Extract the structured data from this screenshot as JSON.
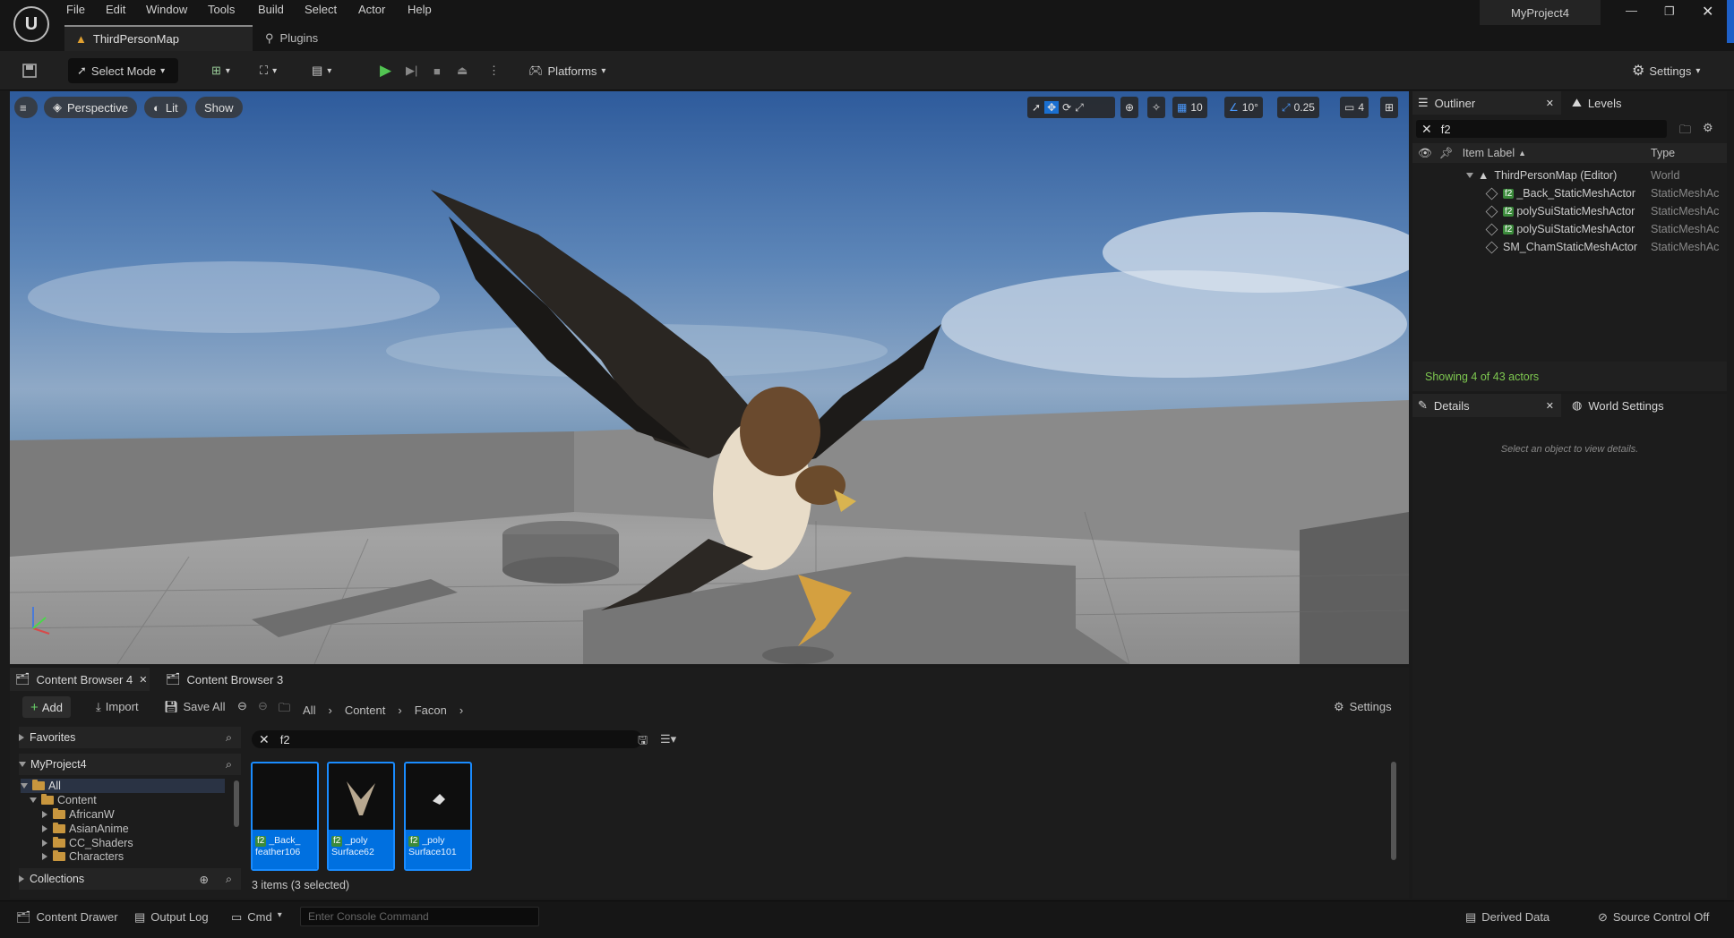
{
  "app": {
    "window_title": "MyProject4"
  },
  "menu": [
    "File",
    "Edit",
    "Window",
    "Tools",
    "Build",
    "Select",
    "Actor",
    "Help"
  ],
  "doc_tabs": [
    {
      "label": "ThirdPersonMap"
    },
    {
      "label": "Plugins"
    }
  ],
  "toolbar": {
    "select_mode": "Select Mode",
    "platforms": "Platforms",
    "settings": "Settings"
  },
  "viewport": {
    "perspective": "Perspective",
    "lit": "Lit",
    "show": "Show",
    "grid_snap": "10",
    "rot_snap": "10°",
    "scale_snap": "0.25",
    "camera_speed": "4"
  },
  "outliner": {
    "tab": "Outliner",
    "levels_tab": "Levels",
    "search_value": "f2",
    "col_label": "Item Label",
    "col_type": "Type",
    "rows": [
      {
        "label": "ThirdPersonMap (Editor)",
        "type": "World",
        "tag": ""
      },
      {
        "label": "_Back_StaticMeshActor",
        "type": "StaticMeshAc",
        "tag": "f2"
      },
      {
        "label": "polySuiStaticMeshActor",
        "type": "StaticMeshAc",
        "tag": "f2"
      },
      {
        "label": "polySuiStaticMeshActor",
        "type": "StaticMeshAc",
        "tag": "f2"
      },
      {
        "label": "SM_ChamStaticMeshActor",
        "type": "StaticMeshAc",
        "tag": ""
      }
    ],
    "status": "Showing 4 of 43 actors"
  },
  "details": {
    "tab": "Details",
    "world_tab": "World Settings",
    "empty_msg": "Select an object to view details."
  },
  "content_browser": {
    "tab1": "Content Browser 4",
    "tab2": "Content Browser 3",
    "add": "Add",
    "import": "Import",
    "save_all": "Save All",
    "breadcrumb": [
      "All",
      "Content",
      "Facon"
    ],
    "settings": "Settings",
    "favorites": "Favorites",
    "project": "MyProject4",
    "tree": [
      "All",
      "Content",
      "AfricanW",
      "AsianAnime",
      "CC_Shaders",
      "Characters"
    ],
    "collections": "Collections",
    "search_value": "f2",
    "assets": [
      {
        "tag": "f2",
        "line1": "_Back_",
        "line2": "feather106"
      },
      {
        "tag": "f2",
        "line1": "_poly",
        "line2": "Surface62"
      },
      {
        "tag": "f2",
        "line1": "_poly",
        "line2": "Surface101"
      }
    ],
    "status": "3 items (3 selected)"
  },
  "statusbar": {
    "content_drawer": "Content Drawer",
    "output_log": "Output Log",
    "cmd": "Cmd",
    "console_placeholder": "Enter Console Command",
    "derived_data": "Derived Data",
    "source_control": "Source Control Off"
  }
}
